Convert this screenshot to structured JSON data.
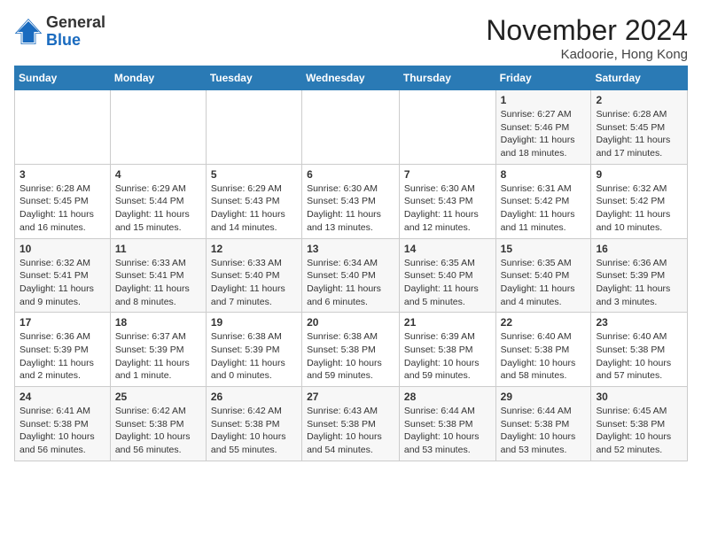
{
  "logo": {
    "general": "General",
    "blue": "Blue"
  },
  "header": {
    "month": "November 2024",
    "location": "Kadoorie, Hong Kong"
  },
  "weekdays": [
    "Sunday",
    "Monday",
    "Tuesday",
    "Wednesday",
    "Thursday",
    "Friday",
    "Saturday"
  ],
  "weeks": [
    [
      {
        "day": "",
        "info": ""
      },
      {
        "day": "",
        "info": ""
      },
      {
        "day": "",
        "info": ""
      },
      {
        "day": "",
        "info": ""
      },
      {
        "day": "",
        "info": ""
      },
      {
        "day": "1",
        "info": "Sunrise: 6:27 AM\nSunset: 5:46 PM\nDaylight: 11 hours and 18 minutes."
      },
      {
        "day": "2",
        "info": "Sunrise: 6:28 AM\nSunset: 5:45 PM\nDaylight: 11 hours and 17 minutes."
      }
    ],
    [
      {
        "day": "3",
        "info": "Sunrise: 6:28 AM\nSunset: 5:45 PM\nDaylight: 11 hours and 16 minutes."
      },
      {
        "day": "4",
        "info": "Sunrise: 6:29 AM\nSunset: 5:44 PM\nDaylight: 11 hours and 15 minutes."
      },
      {
        "day": "5",
        "info": "Sunrise: 6:29 AM\nSunset: 5:43 PM\nDaylight: 11 hours and 14 minutes."
      },
      {
        "day": "6",
        "info": "Sunrise: 6:30 AM\nSunset: 5:43 PM\nDaylight: 11 hours and 13 minutes."
      },
      {
        "day": "7",
        "info": "Sunrise: 6:30 AM\nSunset: 5:43 PM\nDaylight: 11 hours and 12 minutes."
      },
      {
        "day": "8",
        "info": "Sunrise: 6:31 AM\nSunset: 5:42 PM\nDaylight: 11 hours and 11 minutes."
      },
      {
        "day": "9",
        "info": "Sunrise: 6:32 AM\nSunset: 5:42 PM\nDaylight: 11 hours and 10 minutes."
      }
    ],
    [
      {
        "day": "10",
        "info": "Sunrise: 6:32 AM\nSunset: 5:41 PM\nDaylight: 11 hours and 9 minutes."
      },
      {
        "day": "11",
        "info": "Sunrise: 6:33 AM\nSunset: 5:41 PM\nDaylight: 11 hours and 8 minutes."
      },
      {
        "day": "12",
        "info": "Sunrise: 6:33 AM\nSunset: 5:40 PM\nDaylight: 11 hours and 7 minutes."
      },
      {
        "day": "13",
        "info": "Sunrise: 6:34 AM\nSunset: 5:40 PM\nDaylight: 11 hours and 6 minutes."
      },
      {
        "day": "14",
        "info": "Sunrise: 6:35 AM\nSunset: 5:40 PM\nDaylight: 11 hours and 5 minutes."
      },
      {
        "day": "15",
        "info": "Sunrise: 6:35 AM\nSunset: 5:40 PM\nDaylight: 11 hours and 4 minutes."
      },
      {
        "day": "16",
        "info": "Sunrise: 6:36 AM\nSunset: 5:39 PM\nDaylight: 11 hours and 3 minutes."
      }
    ],
    [
      {
        "day": "17",
        "info": "Sunrise: 6:36 AM\nSunset: 5:39 PM\nDaylight: 11 hours and 2 minutes."
      },
      {
        "day": "18",
        "info": "Sunrise: 6:37 AM\nSunset: 5:39 PM\nDaylight: 11 hours and 1 minute."
      },
      {
        "day": "19",
        "info": "Sunrise: 6:38 AM\nSunset: 5:39 PM\nDaylight: 11 hours and 0 minutes."
      },
      {
        "day": "20",
        "info": "Sunrise: 6:38 AM\nSunset: 5:38 PM\nDaylight: 10 hours and 59 minutes."
      },
      {
        "day": "21",
        "info": "Sunrise: 6:39 AM\nSunset: 5:38 PM\nDaylight: 10 hours and 59 minutes."
      },
      {
        "day": "22",
        "info": "Sunrise: 6:40 AM\nSunset: 5:38 PM\nDaylight: 10 hours and 58 minutes."
      },
      {
        "day": "23",
        "info": "Sunrise: 6:40 AM\nSunset: 5:38 PM\nDaylight: 10 hours and 57 minutes."
      }
    ],
    [
      {
        "day": "24",
        "info": "Sunrise: 6:41 AM\nSunset: 5:38 PM\nDaylight: 10 hours and 56 minutes."
      },
      {
        "day": "25",
        "info": "Sunrise: 6:42 AM\nSunset: 5:38 PM\nDaylight: 10 hours and 56 minutes."
      },
      {
        "day": "26",
        "info": "Sunrise: 6:42 AM\nSunset: 5:38 PM\nDaylight: 10 hours and 55 minutes."
      },
      {
        "day": "27",
        "info": "Sunrise: 6:43 AM\nSunset: 5:38 PM\nDaylight: 10 hours and 54 minutes."
      },
      {
        "day": "28",
        "info": "Sunrise: 6:44 AM\nSunset: 5:38 PM\nDaylight: 10 hours and 53 minutes."
      },
      {
        "day": "29",
        "info": "Sunrise: 6:44 AM\nSunset: 5:38 PM\nDaylight: 10 hours and 53 minutes."
      },
      {
        "day": "30",
        "info": "Sunrise: 6:45 AM\nSunset: 5:38 PM\nDaylight: 10 hours and 52 minutes."
      }
    ]
  ]
}
